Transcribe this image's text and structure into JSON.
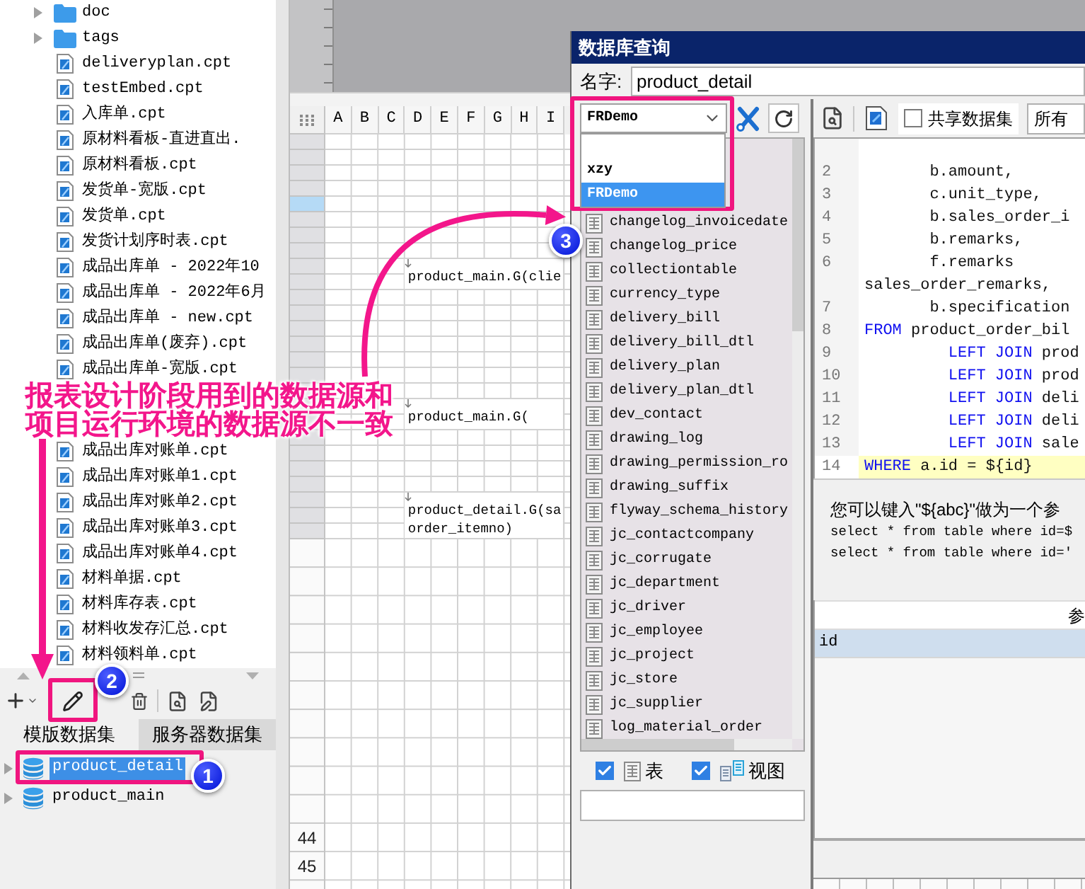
{
  "file_tree": {
    "items": [
      {
        "kind": "folder",
        "label": "doc",
        "expanded": false
      },
      {
        "kind": "folder",
        "label": "tags",
        "expanded": false
      },
      {
        "kind": "file",
        "label": "deliveryplan.cpt"
      },
      {
        "kind": "file",
        "label": "testEmbed.cpt"
      },
      {
        "kind": "file",
        "label": "入库单.cpt"
      },
      {
        "kind": "file",
        "label": "原材料看板-直进直出."
      },
      {
        "kind": "file",
        "label": "原材料看板.cpt"
      },
      {
        "kind": "file",
        "label": "发货单-宽版.cpt"
      },
      {
        "kind": "file",
        "label": "发货单.cpt"
      },
      {
        "kind": "file",
        "label": "发货计划序时表.cpt"
      },
      {
        "kind": "file",
        "label": "成品出库单 - 2022年10"
      },
      {
        "kind": "file",
        "label": "成品出库单 - 2022年6月"
      },
      {
        "kind": "file",
        "label": "成品出库单 - new.cpt"
      },
      {
        "kind": "file",
        "label": "成品出库单(废弃).cpt"
      },
      {
        "kind": "file",
        "label": "成品出库单-宽版.cpt"
      },
      {
        "kind": "file",
        "label": "成品出库对账单.cpt"
      },
      {
        "kind": "file",
        "label": "成品出库对账单1.cpt"
      },
      {
        "kind": "file",
        "label": "成品出库对账单2.cpt"
      },
      {
        "kind": "file",
        "label": "成品出库对账单3.cpt"
      },
      {
        "kind": "file",
        "label": "成品出库对账单4.cpt"
      },
      {
        "kind": "file",
        "label": "材料单据.cpt"
      },
      {
        "kind": "file",
        "label": "材料库存表.cpt"
      },
      {
        "kind": "file",
        "label": "材料收发存汇总.cpt"
      },
      {
        "kind": "file",
        "label": "材料领料单.cpt"
      }
    ]
  },
  "dataset_panel": {
    "tabs": [
      {
        "label": "模版数据集",
        "selected": true
      },
      {
        "label": "服务器数据集",
        "selected": false
      }
    ],
    "datasets": [
      {
        "label": "product_detail",
        "selected": true,
        "expanded": false
      },
      {
        "label": "product_main",
        "selected": false,
        "expanded": false
      }
    ]
  },
  "sheet": {
    "columns": [
      "A",
      "B",
      "C",
      "D",
      "E",
      "F",
      "G",
      "H",
      "I"
    ],
    "rows": [
      {
        "kind": "compact",
        "selected": false
      },
      {
        "kind": "compact",
        "selected": false
      },
      {
        "kind": "compact",
        "selected": false
      },
      {
        "kind": "compact",
        "selected": false
      },
      {
        "kind": "compact",
        "selected": true
      },
      {
        "kind": "compact",
        "selected": false
      },
      {
        "kind": "compact",
        "selected": false
      },
      {
        "kind": "compact",
        "selected": false
      },
      {
        "kind": "merged",
        "selected": false,
        "cell_lines": [
          "product_main.G(clie"
        ]
      },
      {
        "kind": "compact",
        "selected": false
      },
      {
        "kind": "compact",
        "selected": false
      },
      {
        "kind": "compact",
        "selected": false
      },
      {
        "kind": "compact",
        "selected": false
      },
      {
        "kind": "compact",
        "selected": false
      },
      {
        "kind": "compact",
        "selected": false
      },
      {
        "kind": "compact",
        "selected": false
      },
      {
        "kind": "merged",
        "selected": false,
        "cell_lines": [
          "product_main.G("
        ]
      },
      {
        "kind": "compact",
        "selected": false
      },
      {
        "kind": "compact",
        "selected": false
      },
      {
        "kind": "compact",
        "selected": false
      },
      {
        "kind": "compact",
        "selected": false
      },
      {
        "kind": "merged",
        "selected": false,
        "cell_lines": [
          "product_detail.G(sa",
          "order_itemno)"
        ]
      },
      {
        "kind": "normal",
        "selected": false
      },
      {
        "kind": "normal",
        "selected": false
      },
      {
        "kind": "normal",
        "selected": false
      },
      {
        "kind": "normal",
        "selected": false
      },
      {
        "kind": "normal",
        "selected": false
      },
      {
        "kind": "normal",
        "selected": false
      },
      {
        "kind": "normal",
        "selected": false
      },
      {
        "kind": "normal",
        "selected": false
      },
      {
        "kind": "normal",
        "selected": false
      },
      {
        "kind": "normal",
        "selected": false
      },
      {
        "kind": "normal",
        "selected": false,
        "label": "44"
      },
      {
        "kind": "normal",
        "selected": false,
        "label": "45"
      },
      {
        "kind": "normal",
        "selected": false
      }
    ]
  },
  "dialog": {
    "title": "数据库查询",
    "name_label": "名字:",
    "name_value": "product_detail",
    "connection": {
      "value": "FRDemo",
      "options": [
        {
          "label": "xzy",
          "selected": false
        },
        {
          "label": "FRDemo",
          "selected": true
        }
      ]
    },
    "tables": [
      "changelog_invoicedate",
      "changelog_price",
      "collectiontable",
      "currency_type",
      "delivery_bill",
      "delivery_bill_dtl",
      "delivery_plan",
      "delivery_plan_dtl",
      "dev_contact",
      "drawing_log",
      "drawing_permission_ro",
      "drawing_suffix",
      "flyway_schema_history",
      "jc_contactcompany",
      "jc_corrugate",
      "jc_department",
      "jc_driver",
      "jc_employee",
      "jc_project",
      "jc_store",
      "jc_supplier",
      "log_material_order"
    ],
    "filters": [
      {
        "kind": "table",
        "label": "表",
        "checked": true
      },
      {
        "kind": "view",
        "label": "视图",
        "checked": true
      }
    ],
    "shared_dataset": {
      "label": "共享数据集",
      "checked": false
    },
    "scope": "所有",
    "sql_lines": [
      {
        "number": "2",
        "selected": false,
        "segments": [
          {
            "kind": "plain",
            "text": "       b.amount,"
          }
        ]
      },
      {
        "number": "3",
        "selected": false,
        "segments": [
          {
            "kind": "plain",
            "text": "       c.unit_type,"
          }
        ]
      },
      {
        "number": "4",
        "selected": false,
        "segments": [
          {
            "kind": "plain",
            "text": "       b.sales_order_i"
          }
        ]
      },
      {
        "number": "5",
        "selected": false,
        "segments": [
          {
            "kind": "plain",
            "text": "       b.remarks,"
          }
        ]
      },
      {
        "number": "6",
        "selected": false,
        "segments": [
          {
            "kind": "plain",
            "text": "       f.remarks"
          }
        ]
      },
      {
        "selected": false,
        "segments": [
          {
            "kind": "plain",
            "text": "sales_order_remarks,"
          }
        ]
      },
      {
        "number": "7",
        "selected": false,
        "segments": [
          {
            "kind": "plain",
            "text": "       b.specification"
          }
        ]
      },
      {
        "number": "8",
        "selected": false,
        "segments": [
          {
            "kind": "keyword",
            "text": "FROM"
          },
          {
            "kind": "plain",
            "text": " product_order_bil"
          }
        ]
      },
      {
        "number": "9",
        "selected": false,
        "segments": [
          {
            "kind": "keyword",
            "text": "         LEFT JOIN"
          },
          {
            "kind": "plain",
            "text": " prod"
          }
        ]
      },
      {
        "number": "10",
        "selected": false,
        "segments": [
          {
            "kind": "keyword",
            "text": "         LEFT JOIN"
          },
          {
            "kind": "plain",
            "text": " prod"
          }
        ]
      },
      {
        "number": "11",
        "selected": false,
        "segments": [
          {
            "kind": "keyword",
            "text": "         LEFT JOIN"
          },
          {
            "kind": "plain",
            "text": " deli"
          }
        ]
      },
      {
        "number": "12",
        "selected": false,
        "segments": [
          {
            "kind": "keyword",
            "text": "         LEFT JOIN"
          },
          {
            "kind": "plain",
            "text": " deli"
          }
        ]
      },
      {
        "number": "13",
        "selected": false,
        "segments": [
          {
            "kind": "keyword",
            "text": "         LEFT JOIN"
          },
          {
            "kind": "plain",
            "text": " sale"
          }
        ]
      },
      {
        "number": "14",
        "selected": true,
        "segments": [
          {
            "kind": "keyword",
            "text": "WHERE"
          },
          {
            "kind": "plain",
            "text": " a.id = ${id}"
          }
        ]
      }
    ],
    "hint_lines": [
      {
        "kind": "text",
        "text": "您可以键入\"${abc}\"做为一个参"
      },
      {
        "kind": "code",
        "text": "select * from table where id=$"
      },
      {
        "kind": "code",
        "text": "select * from table where id='"
      }
    ],
    "parameters": {
      "header": "参",
      "rows": [
        {
          "name": "id",
          "selected": true
        }
      ]
    }
  },
  "annotation": {
    "lines": [
      "报表设计阶段用到的数据源和",
      "项目运行环境的数据源不一致"
    ]
  },
  "callouts": [
    {
      "number": "1"
    },
    {
      "number": "2"
    },
    {
      "number": "3"
    }
  ]
}
